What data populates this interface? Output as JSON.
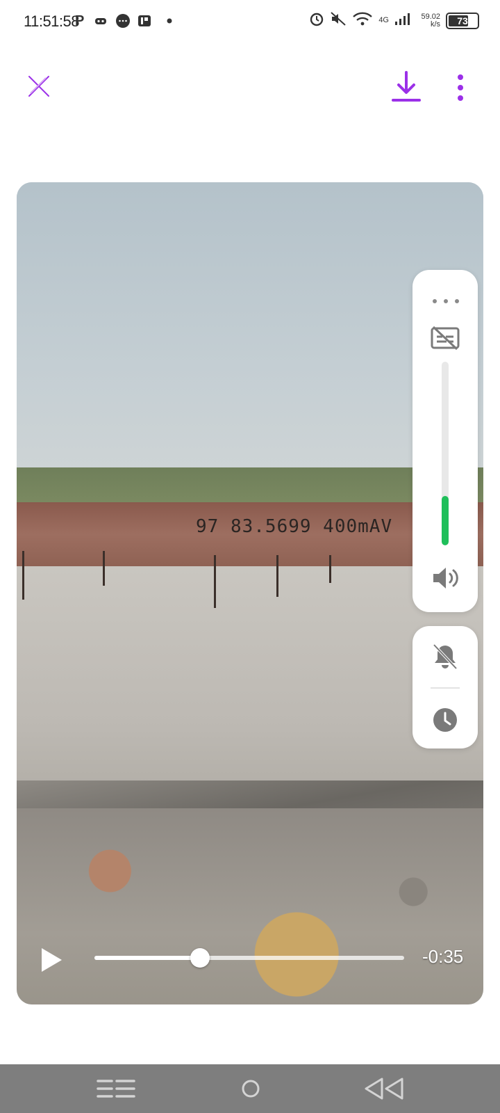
{
  "status_bar": {
    "time": "11:51:58",
    "network_speed": "59.02 k/s",
    "network_type": "4G",
    "battery_level": "73",
    "icons": [
      "p-icon",
      "game-icon",
      "message-icon",
      "app-icon",
      "dot-icon",
      "alarm-icon",
      "mute-icon",
      "wifi-icon",
      "signal-icon",
      "battery-icon"
    ]
  },
  "top_bar": {
    "close_icon": "close-icon",
    "download_icon": "download-icon",
    "more_icon": "more-vertical-icon",
    "accent_color": "#9b30e8"
  },
  "video": {
    "wall_text": "97 83.5699 400mAV",
    "time_remaining": "-0:35",
    "progress": 0.34,
    "play_icon": "play-icon"
  },
  "volume_panel": {
    "more_icon": "more-horizontal-icon",
    "subtitle_icon": "subtitles-off-icon",
    "volume_level": 0.27,
    "volume_color": "#1fbf5a",
    "speaker_icon": "speaker-icon"
  },
  "control_panel": {
    "bell_icon": "bell-off-icon",
    "clock_icon": "clock-icon"
  },
  "nav_bar": {
    "recents_icon": "recents-icon",
    "home_icon": "home-icon",
    "back_icon": "back-icon"
  }
}
